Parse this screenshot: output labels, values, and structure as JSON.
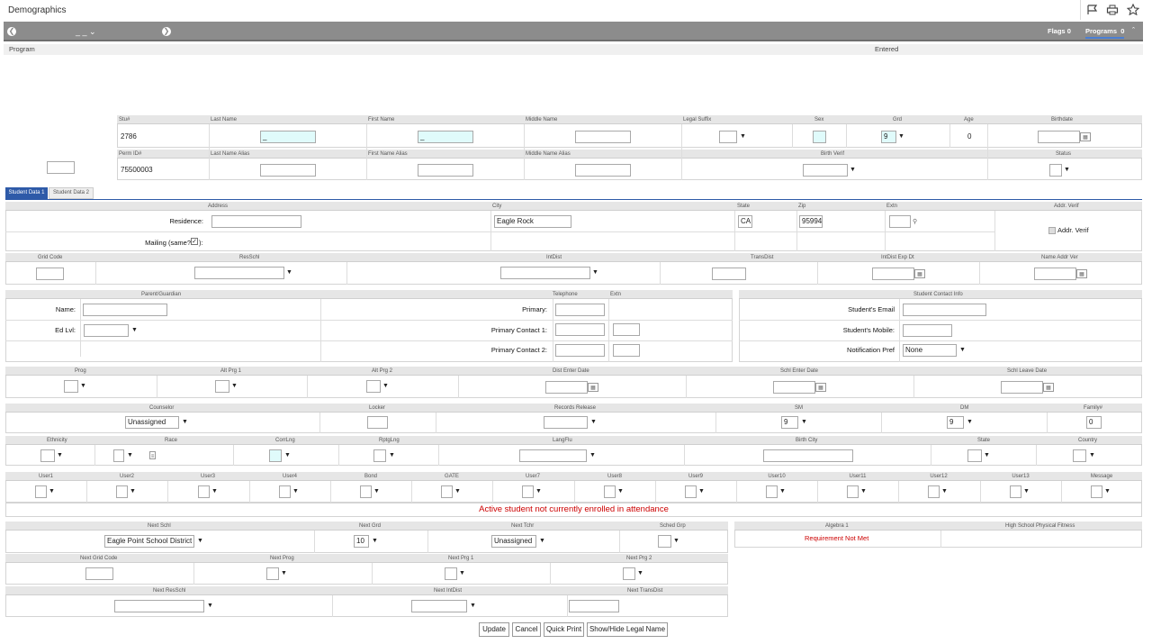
{
  "window": {
    "title": "Demographics"
  },
  "toolbar": {
    "nav_center": "_ _",
    "flags_label": "Flags",
    "flags_count": "0",
    "programs_label": "Programs",
    "programs_count": "0"
  },
  "programs_table": {
    "col_program": "Program",
    "col_entered": "Entered"
  },
  "student": {
    "h_stu": "Stu#",
    "h_last": "Last Name",
    "h_first": "First Name",
    "h_middle": "Middle Name",
    "h_legal": "Legal Suffix",
    "h_sex": "Sex",
    "h_grd": "Grd",
    "h_age": "Age",
    "h_birth": "Birthdate",
    "stu": "2786",
    "last": "_",
    "first": "_",
    "grd": "9",
    "age": "0",
    "h_perm": "Perm ID#",
    "h_lalias": "Last Name Alias",
    "h_falias": "First Name Alias",
    "h_malias": "Middle Name Alias",
    "h_bverif": "Birth Verif",
    "h_status": "Status",
    "perm": "75500003"
  },
  "tabs": [
    "Student Data 1",
    "Student Data 2"
  ],
  "address": {
    "h_address": "Address",
    "h_city": "City",
    "h_state": "State",
    "h_zip": "Zip",
    "h_extn": "Extn",
    "h_verif": "Addr. Verif",
    "residence_label": "Residence:",
    "mailing_label": "Mailing (same?",
    "mailing_suffix": "):",
    "city": "Eagle Rock",
    "state": "CA",
    "zip": "95994",
    "verif_label": "Addr. Verif"
  },
  "codes": {
    "h_grid": "Grid Code",
    "h_resschl": "ResSchl",
    "h_intdist": "IntDist",
    "h_transdist": "TransDist",
    "h_intexp": "IntDist Exp Dt",
    "h_nameaddr": "Name Addr Ver"
  },
  "parent": {
    "h_parent": "Parent/Guardian",
    "h_tel": "Telephone",
    "h_extn": "Extn",
    "h_contact": "Student Contact Info",
    "name_label": "Name:",
    "edlvl_label": "Ed Lvl:",
    "primary_label": "Primary:",
    "pc1_label": "Primary Contact 1:",
    "pc2_label": "Primary Contact 2:",
    "email_label": "Student's Email",
    "mobile_label": "Student's Mobile:",
    "notif_label": "Notification Pref",
    "notif_value": "None"
  },
  "programs_row": {
    "h_prog": "Prog",
    "h_alt1": "Alt Prg 1",
    "h_alt2": "Alt Prg 2",
    "h_dist": "Dist Enter Date",
    "h_schl": "Schl Enter Date",
    "h_leave": "Schl Leave Date"
  },
  "counselor_row": {
    "h_couns": "Counselor",
    "h_locker": "Locker",
    "h_records": "Records Release",
    "h_sm": "SM",
    "h_dm": "DM",
    "h_family": "Family#",
    "couns": "Unassigned",
    "sm": "9",
    "dm": "9",
    "family": "0"
  },
  "ethnicity_row": {
    "h_eth": "Ethnicity",
    "h_race": "Race",
    "h_corr": "CorrLng",
    "h_rptg": "RptgLng",
    "h_flu": "LangFlu",
    "h_bcity": "Birth City",
    "h_state": "State",
    "h_country": "Country"
  },
  "user_row": [
    "User1",
    "User2",
    "User3",
    "User4",
    "Bond",
    "GATE",
    "User7",
    "User8",
    "User9",
    "User10",
    "User11",
    "User12",
    "User13",
    "Message"
  ],
  "status_message": "Active student not currently enrolled in attendance",
  "next": {
    "h_schl": "Next Schl",
    "h_grd": "Next Grd",
    "h_tchr": "Next Tchr",
    "h_sched": "Sched Grp",
    "schl": "Eagle Point School District",
    "grd": "10",
    "tchr": "Unassigned",
    "h_grid": "Next Grid Code",
    "h_prog": "Next Prog",
    "h_prg1": "Next Prg 1",
    "h_prg2": "Next Prg 2",
    "h_res": "Next ResSchl",
    "h_int": "Next IntDist",
    "h_trans": "Next TransDist"
  },
  "tests": {
    "h_alg": "Algebra 1",
    "h_pf": "High School Physical Fitness",
    "alg": "Requirement Not Met"
  },
  "buttons": {
    "update": "Update",
    "cancel": "Cancel",
    "print": "Quick Print",
    "legal": "Show/Hide Legal Name"
  },
  "colors": {
    "toolbar": "#8c8c8c",
    "tab_active": "#2e5aa8",
    "status_red": "#cc0000",
    "cyan": "#e0fbfb"
  }
}
